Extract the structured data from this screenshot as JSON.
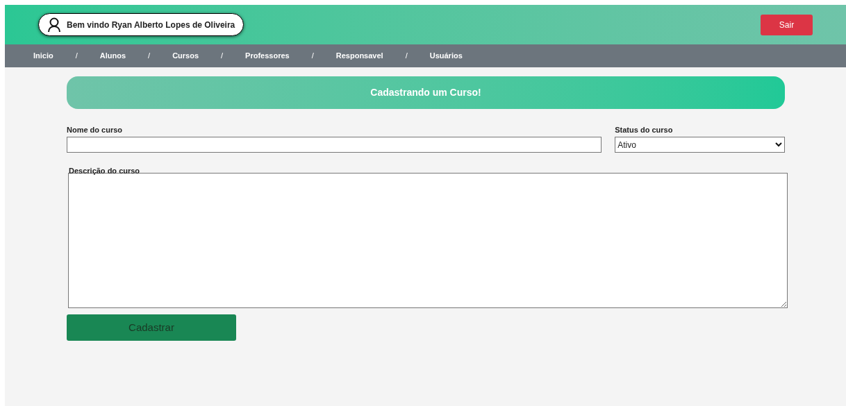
{
  "header": {
    "welcome": "Bem vindo Ryan Alberto Lopes de Oliveira",
    "logout_button": "Sair"
  },
  "nav": [
    {
      "kind": "link",
      "label": "Inicio"
    },
    {
      "kind": "separator",
      "label": "/"
    },
    {
      "kind": "link",
      "label": "Alunos"
    },
    {
      "kind": "separator",
      "label": "/"
    },
    {
      "kind": "link",
      "label": "Cursos"
    },
    {
      "kind": "separator",
      "label": "/"
    },
    {
      "kind": "link",
      "label": "Professores"
    },
    {
      "kind": "separator",
      "label": "/"
    },
    {
      "kind": "link",
      "label": "Responsavel"
    },
    {
      "kind": "separator",
      "label": "/"
    },
    {
      "kind": "link",
      "label": "Usuários"
    }
  ],
  "banner": "Cadastrando um Curso!",
  "form": {
    "name_label": "Nome do curso",
    "status_label": "Status do curso",
    "status_value": "Ativo",
    "description_label": "Descrição do curso",
    "submit_button": "Cadastrar"
  }
}
